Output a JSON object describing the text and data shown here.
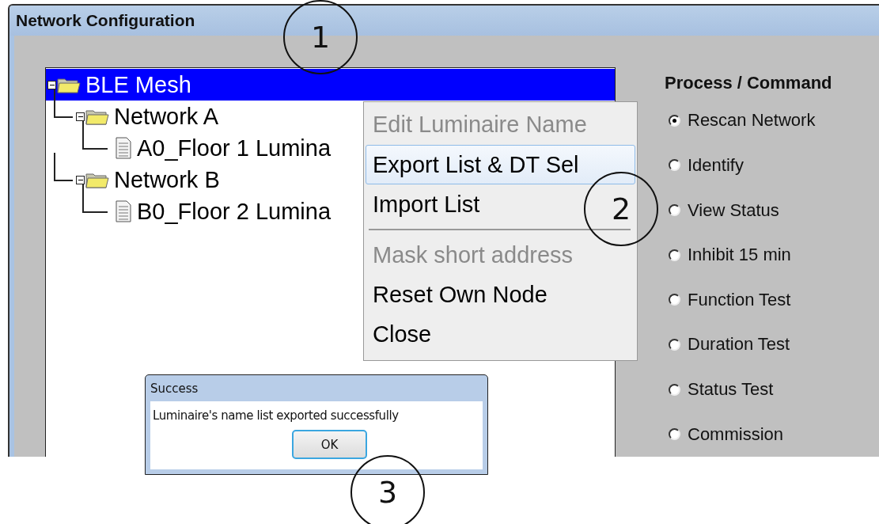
{
  "window": {
    "title": "Network Configuration"
  },
  "tree": [
    {
      "label": "BLE Mesh",
      "kind": "folder",
      "selected": true,
      "expanded": true,
      "children": [
        {
          "label": "Network A",
          "kind": "folder",
          "selected": false,
          "expanded": true,
          "children": [
            {
              "label": "A0_Floor 1 Lumina",
              "kind": "document",
              "selected": false
            }
          ]
        },
        {
          "label": "Network B",
          "kind": "folder",
          "selected": false,
          "expanded": true,
          "children": [
            {
              "label": "B0_Floor 2 Lumina",
              "kind": "document",
              "selected": false
            }
          ]
        }
      ]
    }
  ],
  "context_menu": [
    {
      "kind": "item",
      "label": "Edit Luminaire Name",
      "disabled": true,
      "highlighted": false
    },
    {
      "kind": "item",
      "label": "Export List & DT Sel",
      "disabled": false,
      "highlighted": true
    },
    {
      "kind": "item",
      "label": "Import List",
      "disabled": false,
      "highlighted": false
    },
    {
      "kind": "separator"
    },
    {
      "kind": "item",
      "label": "Mask short address",
      "disabled": true,
      "highlighted": false
    },
    {
      "kind": "item",
      "label": "Reset Own Node",
      "disabled": false,
      "highlighted": false
    },
    {
      "kind": "item",
      "label": "Close",
      "disabled": false,
      "highlighted": false
    }
  ],
  "process_panel": {
    "title": "Process / Command",
    "options": [
      {
        "label": "Rescan Network",
        "selected": true
      },
      {
        "label": "Identify",
        "selected": false
      },
      {
        "label": "View Status",
        "selected": false
      },
      {
        "label": "Inhibit 15 min",
        "selected": false
      },
      {
        "label": "Function Test",
        "selected": false
      },
      {
        "label": "Duration Test",
        "selected": false
      },
      {
        "label": "Status Test",
        "selected": false
      },
      {
        "label": "Commission",
        "selected": false
      }
    ]
  },
  "dialog": {
    "title": "Success",
    "message": "Luminaire's name list exported successfully",
    "button": "OK"
  },
  "callouts": [
    "1",
    "2",
    "3"
  ]
}
